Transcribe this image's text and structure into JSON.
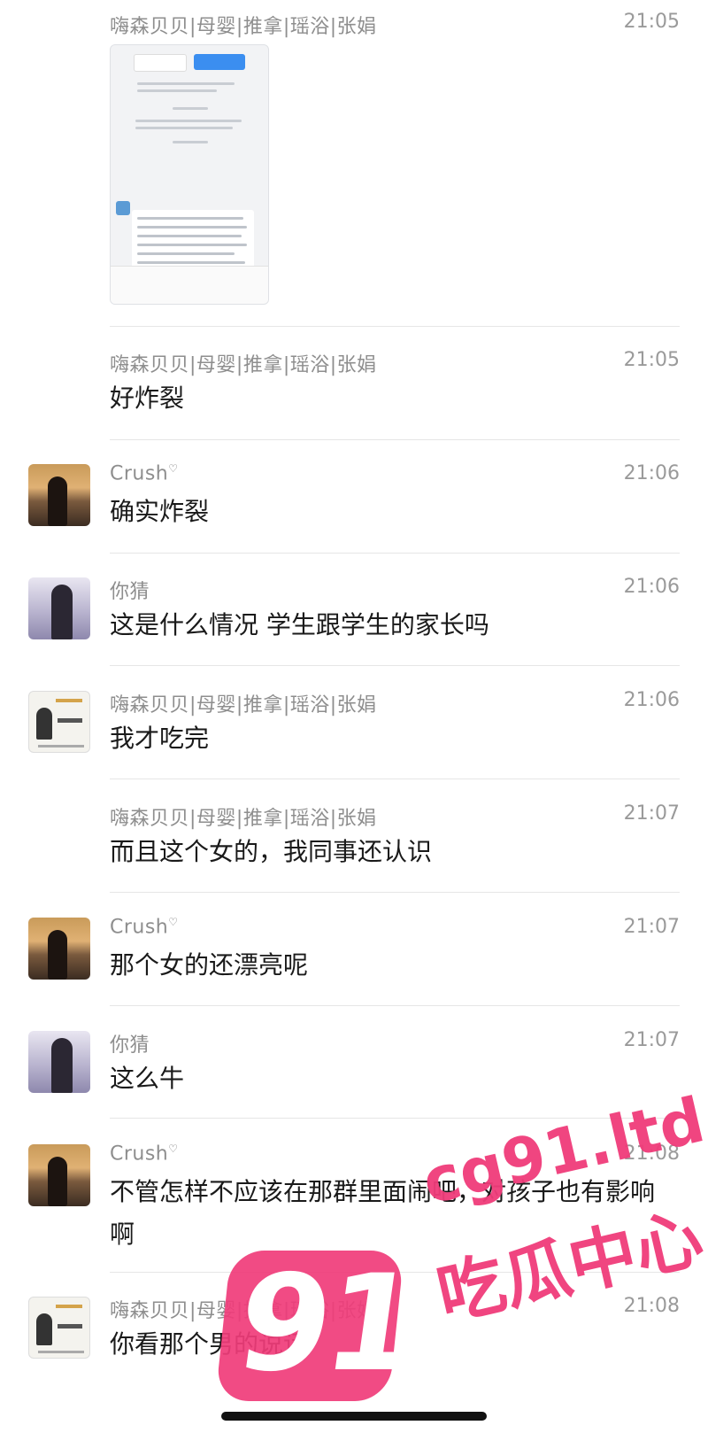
{
  "messages": [
    {
      "name": "嗨森贝贝|母婴|推拿|瑶浴|张娟",
      "time": "21:05",
      "text": "",
      "type": "image"
    },
    {
      "name": "嗨森贝贝|母婴|推拿|瑶浴|张娟",
      "time": "21:05",
      "text": "好炸裂"
    },
    {
      "name": "Crush",
      "time": "21:06",
      "text": "确实炸裂"
    },
    {
      "name": "你猜",
      "time": "21:06",
      "text": "这是什么情况 学生跟学生的家长吗"
    },
    {
      "name": "嗨森贝贝|母婴|推拿|瑶浴|张娟",
      "time": "21:06",
      "text": "我才吃完"
    },
    {
      "name": "嗨森贝贝|母婴|推拿|瑶浴|张娟",
      "time": "21:07",
      "text": "而且这个女的，我同事还认识"
    },
    {
      "name": "Crush",
      "time": "21:07",
      "text": "那个女的还漂亮呢"
    },
    {
      "name": "你猜",
      "time": "21:07",
      "text": "这么牛"
    },
    {
      "name": "Crush",
      "time": "21:08",
      "text": "不管怎样不应该在那群里面闹吧，对孩子也有影响啊"
    },
    {
      "name": "嗨森贝贝|母婴|推拿|瑶浴|张娟",
      "time": "21:08",
      "text": "你看那个男的说话"
    }
  ],
  "watermark": {
    "number": "91",
    "domain": "cg91.ltd",
    "label": "吃瓜中心",
    "color": "#f03c7a"
  },
  "icons": {
    "crush_badge": "heart-ribbon-icon"
  }
}
